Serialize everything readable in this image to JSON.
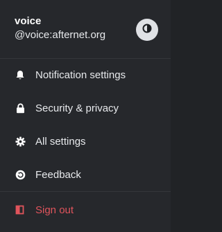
{
  "user": {
    "display_name": "voice",
    "user_id": "@voice:afternet.org"
  },
  "theme_toggle": {
    "icon": "half-circle-contrast-icon"
  },
  "menu": {
    "notification_settings": {
      "label": "Notification settings",
      "icon": "bell-icon"
    },
    "security_privacy": {
      "label": "Security & privacy",
      "icon": "lock-icon"
    },
    "all_settings": {
      "label": "All settings",
      "icon": "gear-icon"
    },
    "feedback": {
      "label": "Feedback",
      "icon": "feedback-icon"
    },
    "sign_out": {
      "label": "Sign out",
      "icon": "sign-out-icon"
    }
  },
  "colors": {
    "background": "#26282c",
    "text": "#e8eaed",
    "danger": "#e0545c",
    "toggle_bg": "#dfe1e5"
  }
}
